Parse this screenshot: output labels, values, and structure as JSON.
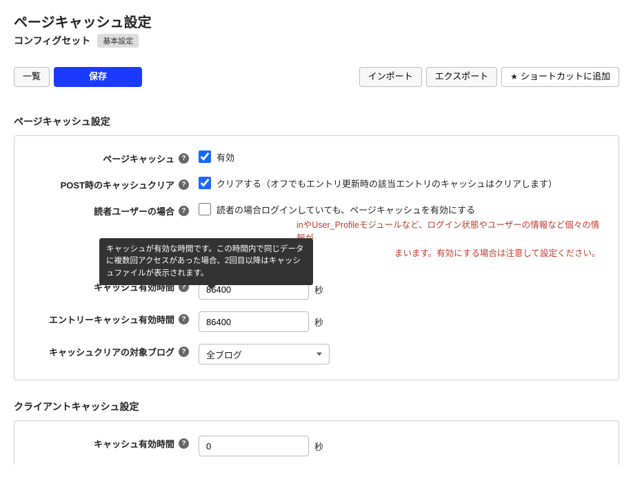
{
  "header": {
    "title": "ページキャッシュ設定",
    "configset_label": "コンフィグセット",
    "configset_badge": "基本設定"
  },
  "toolbar": {
    "list_label": "一覧",
    "save_label": "保存",
    "import_label": "インポート",
    "export_label": "エクスポート",
    "shortcut_label": "ショートカットに追加"
  },
  "sections": {
    "page_cache": {
      "title": "ページキャッシュ設定",
      "rows": {
        "page_cache": {
          "label": "ページキャッシュ",
          "checkbox_label": "有効",
          "checked": true
        },
        "post_clear": {
          "label": "POST時のキャッシュクリア",
          "checkbox_label": "クリアする（オフでもエントリ更新時の該当エントリのキャッシュはクリアします）",
          "checked": true
        },
        "reader_user": {
          "label": "読者ユーザーの場合",
          "checkbox_label": "読者の場合ログインしていても、ページキャッシュを有効にする",
          "checked": false,
          "note_frag_left": "inやUser_Profileモジュールなど、ログイン状態やユーザーの情報など個々の情報が",
          "note_right": "まいます。有効にする場合は注意して設定ください。"
        },
        "cache_ttl": {
          "label": "キャッシュ有効時間",
          "value": "86400",
          "unit": "秒",
          "tooltip": "キャッシュが有効な時間です。この時間内で同じデータに複数回アクセスがあった場合、2回目以降はキャッシュファイルが表示されます。"
        },
        "entry_cache_ttl": {
          "label": "エントリーキャッシュ有効時間",
          "value": "86400",
          "unit": "秒"
        },
        "clear_target": {
          "label": "キャッシュクリアの対象ブログ",
          "selected": "全ブログ"
        }
      }
    },
    "client_cache": {
      "title": "クライアントキャッシュ設定",
      "rows": {
        "cache_ttl": {
          "label": "キャッシュ有効時間",
          "value": "0",
          "unit": "秒"
        }
      }
    }
  }
}
